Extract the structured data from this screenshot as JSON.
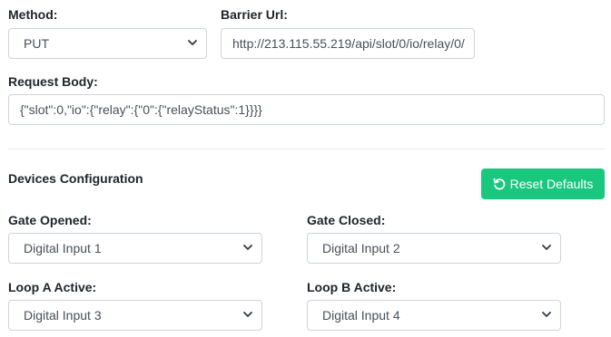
{
  "method": {
    "label": "Method:",
    "value": "PUT"
  },
  "barrier_url": {
    "label": "Barrier Url:",
    "value": "http://213.115.55.219/api/slot/0/io/relay/0/"
  },
  "request_body": {
    "label": "Request Body:",
    "value": "{\"slot\":0,\"io\":{\"relay\":{\"0\":{\"relayStatus\":1}}}}"
  },
  "devices": {
    "title": "Devices Configuration",
    "reset_label": "Reset Defaults",
    "gate_opened": {
      "label": "Gate Opened:",
      "value": "Digital Input 1"
    },
    "gate_closed": {
      "label": "Gate Closed:",
      "value": "Digital Input 2"
    },
    "loop_a": {
      "label": "Loop A Active:",
      "value": "Digital Input 3"
    },
    "loop_b": {
      "label": "Loop B Active:",
      "value": "Digital Input 4"
    }
  },
  "colors": {
    "accent": "#19c77f",
    "border": "#ced4da",
    "text": "#212529"
  },
  "icons": {
    "select_arrow": "chevron-down-icon",
    "reset": "undo-icon"
  }
}
